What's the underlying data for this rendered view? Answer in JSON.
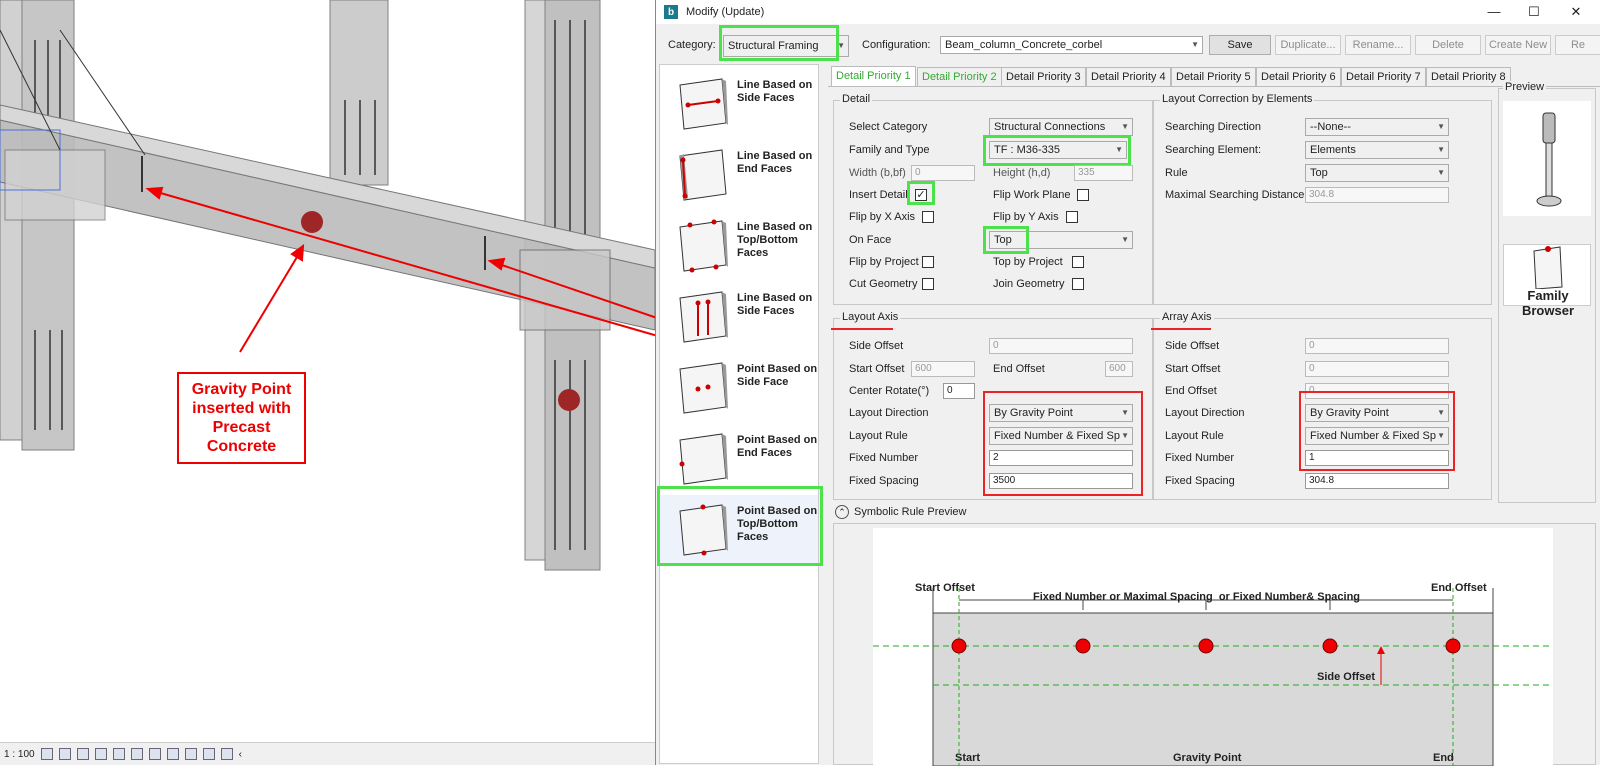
{
  "viewport": {
    "scale_label": "1 : 100",
    "callout_text": "Gravity Point inserted with Precast Concrete"
  },
  "dialog": {
    "title": "Modify (Update)",
    "window_controls": {
      "minimize": "—",
      "maximize": "☐",
      "close": "✕"
    },
    "category_label": "Category:",
    "category_value": "Structural Framing",
    "configuration_label": "Configuration:",
    "configuration_value": "Beam_column_Concrete_corbel",
    "buttons": {
      "save": "Save",
      "duplicate": "Duplicate...",
      "rename": "Rename...",
      "delete": "Delete",
      "create_new": "Create New",
      "re": "Re"
    },
    "tabs": [
      "Detail Priority 1",
      "Detail Priority 2",
      "Detail Priority 3",
      "Detail Priority 4",
      "Detail Priority 5",
      "Detail Priority 6",
      "Detail Priority 7",
      "Detail Priority 8"
    ],
    "rule_types": [
      {
        "label": "Line Based on Side Faces"
      },
      {
        "label": "Line Based on End Faces"
      },
      {
        "label": "Line Based on Top/Bottom Faces"
      },
      {
        "label": "Line Based on Side Faces"
      },
      {
        "label": "Point Based on Side Face"
      },
      {
        "label": "Point Based on End Faces"
      },
      {
        "label": "Point Based on Top/Bottom Faces"
      }
    ],
    "detail": {
      "title": "Detail",
      "select_category_label": "Select Category",
      "select_category_value": "Structural Connections",
      "family_type_label": "Family and Type",
      "family_type_value": "TF : M36-335",
      "width_label": "Width (b,bf)",
      "width_value": "0",
      "height_label": "Height (h,d)",
      "height_value": "335",
      "insert_detail_label": "Insert Detail",
      "insert_detail_check": "✓",
      "flip_work_plane_label": "Flip Work Plane",
      "flip_x_label": "Flip by X Axis",
      "flip_y_label": "Flip by Y Axis",
      "on_face_label": "On Face",
      "on_face_value": "Top",
      "flip_project_label": "Flip by Project",
      "top_project_label": "Top by Project",
      "cut_geometry_label": "Cut Geometry",
      "join_geometry_label": "Join Geometry"
    },
    "layout_correction": {
      "title": "Layout Correction by Elements",
      "direction_label": "Searching Direction",
      "direction_value": "--None--",
      "element_label": "Searching  Element:",
      "element_value": "Elements",
      "rule_label": "Rule",
      "rule_value": "Top",
      "max_dist_label": "Maximal Searching Distance",
      "max_dist_value": "304.8"
    },
    "preview": {
      "title": "Preview",
      "family_browser": "Family Browser"
    },
    "layout_axis": {
      "title": "Layout Axis",
      "side_offset_label": "Side Offset",
      "side_offset_value": "0",
      "start_offset_label": "Start Offset",
      "start_offset_value": "600",
      "end_offset_label": "End Offset",
      "end_offset_value": "600",
      "center_rotate_label": "Center Rotate(°)",
      "center_rotate_value": "0",
      "layout_direction_label": "Layout Direction",
      "layout_direction_value": "By Gravity Point",
      "layout_rule_label": "Layout Rule",
      "layout_rule_value": "Fixed Number & Fixed Sp",
      "fixed_number_label": "Fixed Number",
      "fixed_number_value": "2",
      "fixed_spacing_label": "Fixed Spacing",
      "fixed_spacing_value": "3500"
    },
    "array_axis": {
      "title": "Array Axis",
      "side_offset_label": "Side Offset",
      "side_offset_value": "0",
      "start_offset_label": "Start Offset",
      "start_offset_value": "0",
      "end_offset_label": "End Offset",
      "end_offset_value": "0",
      "layout_direction_label": "Layout Direction",
      "layout_direction_value": "By Gravity Point",
      "layout_rule_label": "Layout Rule",
      "layout_rule_value": "Fixed Number & Fixed Sp",
      "fixed_number_label": "Fixed Number",
      "fixed_number_value": "1",
      "fixed_spacing_label": "Fixed Spacing",
      "fixed_spacing_value": "304.8"
    },
    "symbolic": {
      "title": "Symbolic Rule Preview",
      "start_offset": "Start Offset",
      "end_offset": "End Offset",
      "spacing_text": "Fixed Number or Maximal Spacing  or Fixed Number& Spacing",
      "side_offset": "Side Offset",
      "start": "Start",
      "gravity_point": "Gravity Point",
      "end": "End"
    }
  }
}
